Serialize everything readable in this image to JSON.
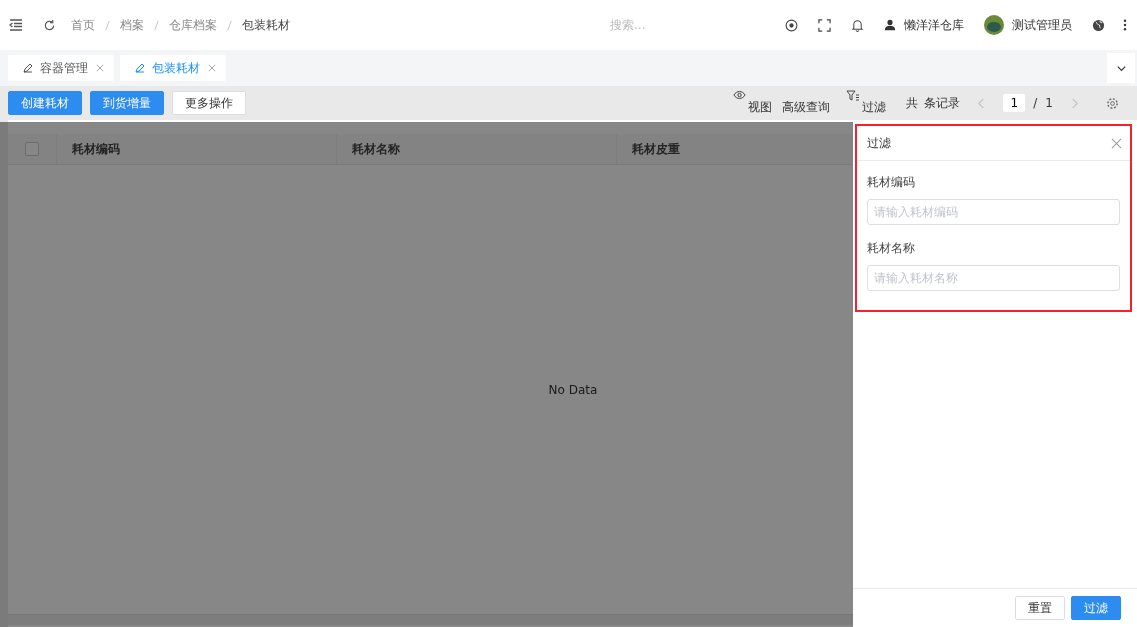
{
  "breadcrumbs": [
    {
      "label": "首页",
      "current": false
    },
    {
      "label": "档案",
      "current": false
    },
    {
      "label": "仓库档案",
      "current": false
    },
    {
      "label": "包装耗材",
      "current": true
    }
  ],
  "search": {
    "placeholder": "搜索..."
  },
  "warehouse": "懒洋洋仓库",
  "user": "测试管理员",
  "tabs": [
    {
      "label": "容器管理",
      "selected": false
    },
    {
      "label": "包装耗材",
      "selected": true
    }
  ],
  "actions": [
    {
      "label": "创建耗材",
      "kind": "primary"
    },
    {
      "label": "到货增量",
      "kind": "primary"
    },
    {
      "label": "更多操作",
      "kind": "default"
    }
  ],
  "toolbar": {
    "view": "视图",
    "advanced_query": "高级查询",
    "filter": "过滤",
    "total_prefix": "共",
    "total_suffix": "条记录",
    "page": "1",
    "separator": "/",
    "pages": "1"
  },
  "table": {
    "select_all_checked": false,
    "columns": [
      "耗材编码",
      "耗材名称",
      "耗材皮重"
    ],
    "empty": "No Data"
  },
  "drawer": {
    "title": "过滤",
    "fields": [
      {
        "label": "耗材编码",
        "placeholder": "请输入耗材编码"
      },
      {
        "label": "耗材名称",
        "placeholder": "请输入耗材名称"
      }
    ],
    "buttons": [
      {
        "label": "重置",
        "kind": "default"
      },
      {
        "label": "过滤",
        "kind": "primary"
      }
    ]
  }
}
